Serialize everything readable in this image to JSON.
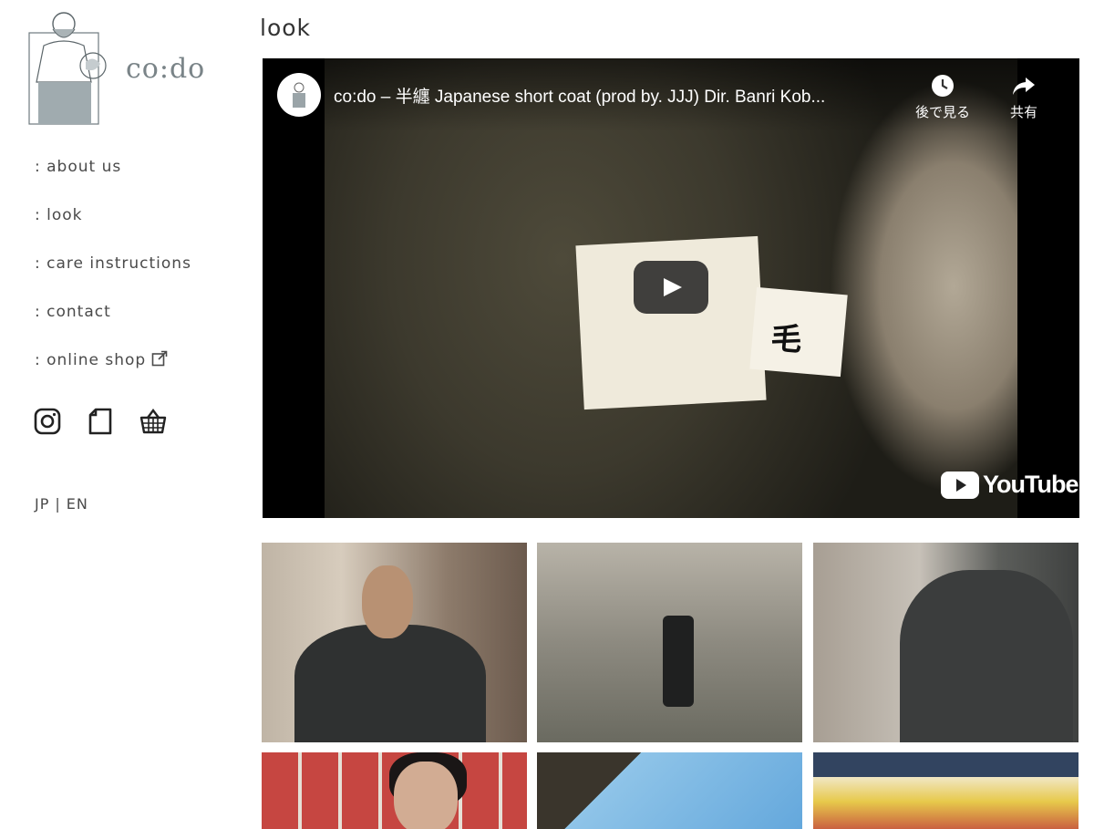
{
  "logo": {
    "wordmark": "co:do"
  },
  "nav": {
    "items": [
      {
        "label": ": about us"
      },
      {
        "label": ": look"
      },
      {
        "label": ": care instructions"
      },
      {
        "label": ": contact"
      },
      {
        "label": ": online shop"
      }
    ]
  },
  "social": {
    "icons": [
      "instagram-icon",
      "note-icon",
      "shop-basket-icon"
    ]
  },
  "lang": {
    "jp": "JP",
    "separator": "|",
    "en": "EN"
  },
  "main": {
    "title": "look"
  },
  "video": {
    "title": "co:do – 半纏 Japanese short coat (prod by. JJJ) Dir. Banri Kob...",
    "watch_later": "後で見る",
    "share": "共有",
    "platform": "YouTube",
    "label_kanji": "毛"
  },
  "colors": {
    "text": "#4a4a4a",
    "video_bg": "#000000",
    "youtube_red": "#ff0000"
  }
}
